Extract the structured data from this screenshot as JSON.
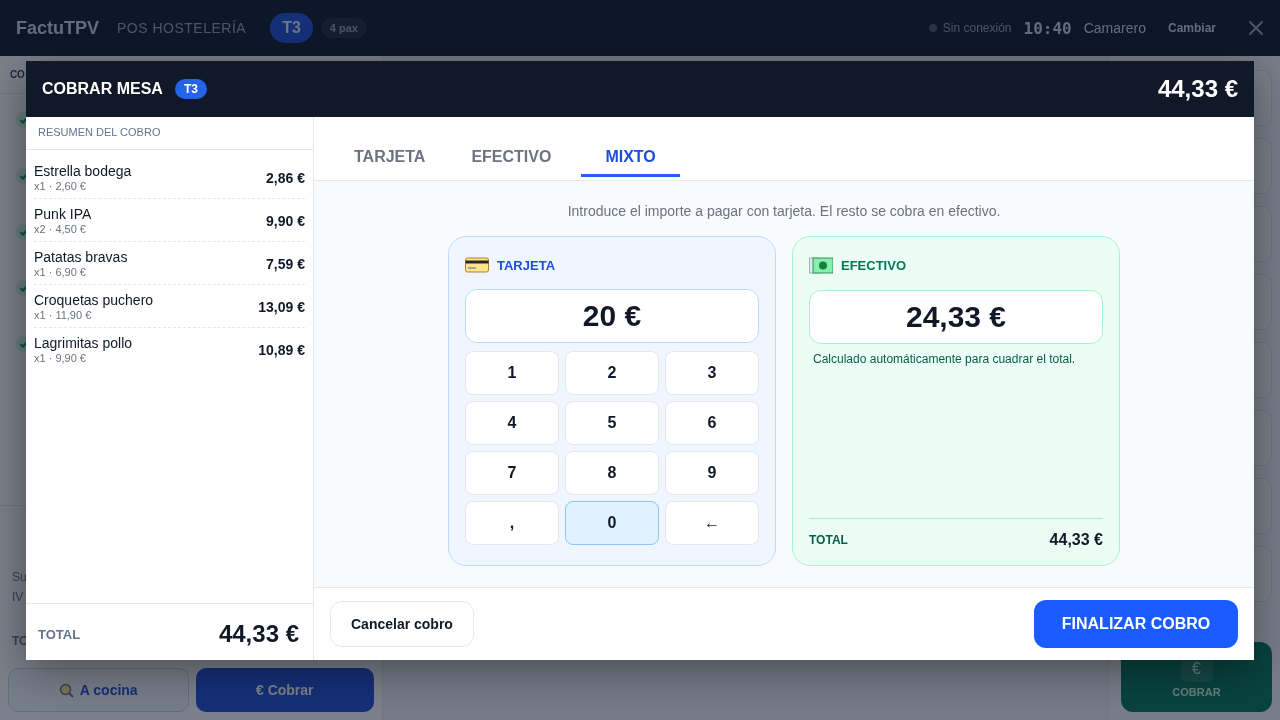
{
  "topbar": {
    "brand": "FactuTPV",
    "subtitle": "POS HOSTELERÍA",
    "table_badge": "T3",
    "guests": "4 pax",
    "connection": "Sin conexión",
    "online": false,
    "time": "10:40",
    "user": "Camarero",
    "switch_button": "Cambiar"
  },
  "order_panel": {
    "header": "CO",
    "lines": [
      {
        "sent": true
      },
      {
        "sent": true
      },
      {
        "sent": true
      },
      {
        "sent": true
      },
      {
        "sent": true
      }
    ],
    "totals_labels": [
      "Su",
      "IV",
      "TO"
    ],
    "actions": [
      {
        "kind": "kitchen",
        "label": "A cocina"
      },
      {
        "kind": "pay",
        "icon": "€",
        "label": "Cobrar"
      }
    ]
  },
  "pay_tile": {
    "icon": "€",
    "label": "COBRAR"
  },
  "modal": {
    "title": "COBRAR MESA",
    "badge": "T3",
    "amount": "44,33 €",
    "summary": {
      "heading": "RESUMEN DEL COBRO",
      "items": [
        {
          "name": "Estrella bodega",
          "detail": "x1 · 2,60 €",
          "amount": "2,86 €"
        },
        {
          "name": "Punk IPA",
          "detail": "x2 · 4,50 €",
          "amount": "9,90 €"
        },
        {
          "name": "Patatas bravas",
          "detail": "x1 · 6,90 €",
          "amount": "7,59 €"
        },
        {
          "name": "Croquetas puchero",
          "detail": "x1 · 11,90 €",
          "amount": "13,09 €"
        },
        {
          "name": "Lagrimitas pollo",
          "detail": "x1 · 9,90 €",
          "amount": "10,89 €"
        }
      ],
      "total_label": "TOTAL",
      "total": "44,33 €"
    },
    "tabs": [
      {
        "label": "TARJETA",
        "selected": false
      },
      {
        "label": "EFECTIVO",
        "selected": false
      },
      {
        "label": "MIXTO",
        "selected": true
      }
    ],
    "hint": "Introduce el importe a pagar con tarjeta. El resto se cobra en efectivo.",
    "card_panel": {
      "title": "TARJETA",
      "amount": "20 €",
      "keys": [
        {
          "label": "1",
          "selected": false
        },
        {
          "label": "2",
          "selected": false
        },
        {
          "label": "3",
          "selected": false
        },
        {
          "label": "4",
          "selected": false
        },
        {
          "label": "5",
          "selected": false
        },
        {
          "label": "6",
          "selected": false
        },
        {
          "label": "7",
          "selected": false
        },
        {
          "label": "8",
          "selected": false
        },
        {
          "label": "9",
          "selected": false
        },
        {
          "label": ",",
          "selected": false
        },
        {
          "label": "0",
          "selected": true
        },
        {
          "label": "←",
          "selected": false
        }
      ]
    },
    "cash_panel": {
      "title": "EFECTIVO",
      "amount": "24,33 €",
      "note": "Calculado automáticamente para cuadrar el total.",
      "total_label": "TOTAL",
      "total": "44,33 €"
    },
    "cancel_button": "Cancelar cobro",
    "finalize_button": "FINALIZAR COBRO"
  }
}
